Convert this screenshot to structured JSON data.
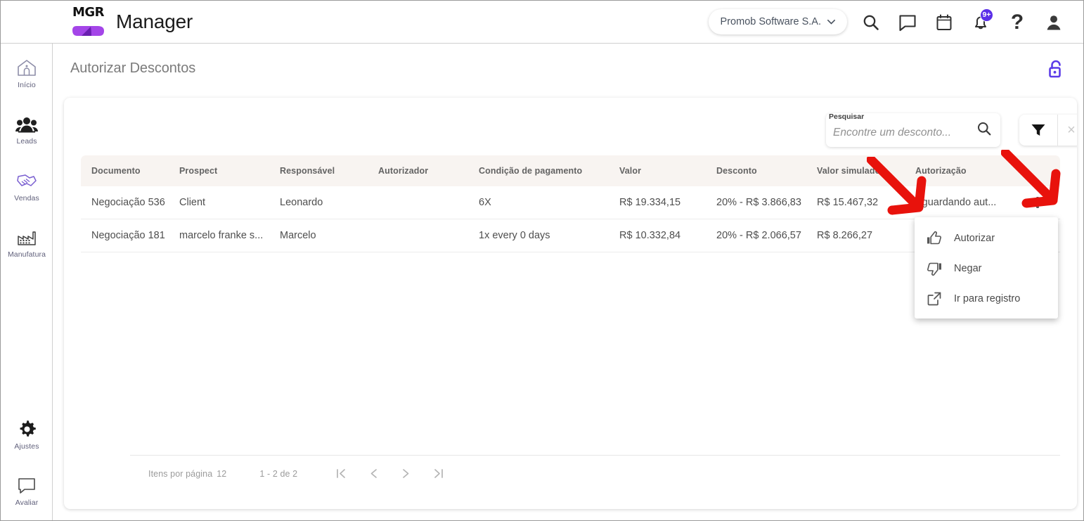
{
  "app": {
    "logo_text": "MGR",
    "brand_title": "Manager"
  },
  "header": {
    "company_selector": "Promob Software S.A.",
    "icons": [
      {
        "name": "search-icon",
        "label": "Pesquisar"
      },
      {
        "name": "chat-icon",
        "label": "Mensagens"
      },
      {
        "name": "calendar-icon",
        "label": "Agenda"
      },
      {
        "name": "bell-icon",
        "label": "Notificações",
        "badge": "9+"
      },
      {
        "name": "help-icon",
        "label": "Ajuda"
      },
      {
        "name": "user-avatar-icon",
        "label": "Perfil"
      }
    ],
    "notification_badge": "9+",
    "help_glyph": "?"
  },
  "sidebar": {
    "items": [
      {
        "icon": "home-icon",
        "label": "Início"
      },
      {
        "icon": "people-icon",
        "label": "Leads"
      },
      {
        "icon": "handshake-icon",
        "label": "Vendas"
      },
      {
        "icon": "factory-icon",
        "label": "Manufatura"
      }
    ],
    "bottom_items": [
      {
        "icon": "gear-icon",
        "label": "Ajustes"
      },
      {
        "icon": "feedback-icon",
        "label": "Avaliar"
      }
    ]
  },
  "page": {
    "title": "Autorizar Descontos",
    "lock_icon": "unlock-icon"
  },
  "search": {
    "float_label": "Pesquisar",
    "placeholder": "Encontre um desconto...",
    "value": ""
  },
  "toolbar": {
    "filter_icon": "funnel-icon",
    "clear_filter_icon": "close-icon",
    "clear_glyph": "×"
  },
  "table": {
    "columns": [
      "Documento",
      "Prospect",
      "Responsável",
      "Autorizador",
      "Condição de pagamento",
      "Valor",
      "Desconto",
      "Valor simulado",
      "Autorização"
    ],
    "rows": [
      {
        "documento": "Negociação 536",
        "prospect": "Client",
        "responsavel": "Leonardo",
        "autorizador": "",
        "condicao": "6X",
        "valor": "R$ 19.334,15",
        "desconto": "20% - R$ 3.866,83",
        "valor_simulado": "R$ 15.467,32",
        "autorizacao": "Aguardando aut..."
      },
      {
        "documento": "Negociação 181",
        "prospect": "marcelo franke s...",
        "responsavel": "Marcelo",
        "autorizador": "",
        "condicao": "1x every 0 days",
        "valor": "R$ 10.332,84",
        "desconto": "20% - R$ 2.066,57",
        "valor_simulado": "R$ 8.266,27",
        "autorizacao": ""
      }
    ]
  },
  "context_menu": {
    "items": [
      {
        "icon": "thumbs-up-icon",
        "label": "Autorizar"
      },
      {
        "icon": "thumbs-down-icon",
        "label": "Negar"
      },
      {
        "icon": "external-link-icon",
        "label": "Ir para registro"
      }
    ]
  },
  "paginator": {
    "items_per_page_label": "Itens por página",
    "items_per_page_value": "12",
    "range": "1 - 2 de 2",
    "first_icon": "first-page-icon",
    "prev_icon": "prev-page-icon",
    "next_icon": "next-page-icon",
    "last_icon": "last-page-icon"
  },
  "colors": {
    "accent_purple": "#5b2fe8",
    "logo_purple": "#a445e8",
    "logo_purple_dark": "#6a1fb0",
    "table_header_bg": "#f8f4f1",
    "annotation_red": "#e8120c",
    "title_gray": "#7b7b7b"
  },
  "annotations": {
    "arrows": [
      {
        "name": "arrow-to-menu-item",
        "color": "#e8120c"
      },
      {
        "name": "arrow-to-kebab-button",
        "color": "#e8120c"
      }
    ]
  }
}
